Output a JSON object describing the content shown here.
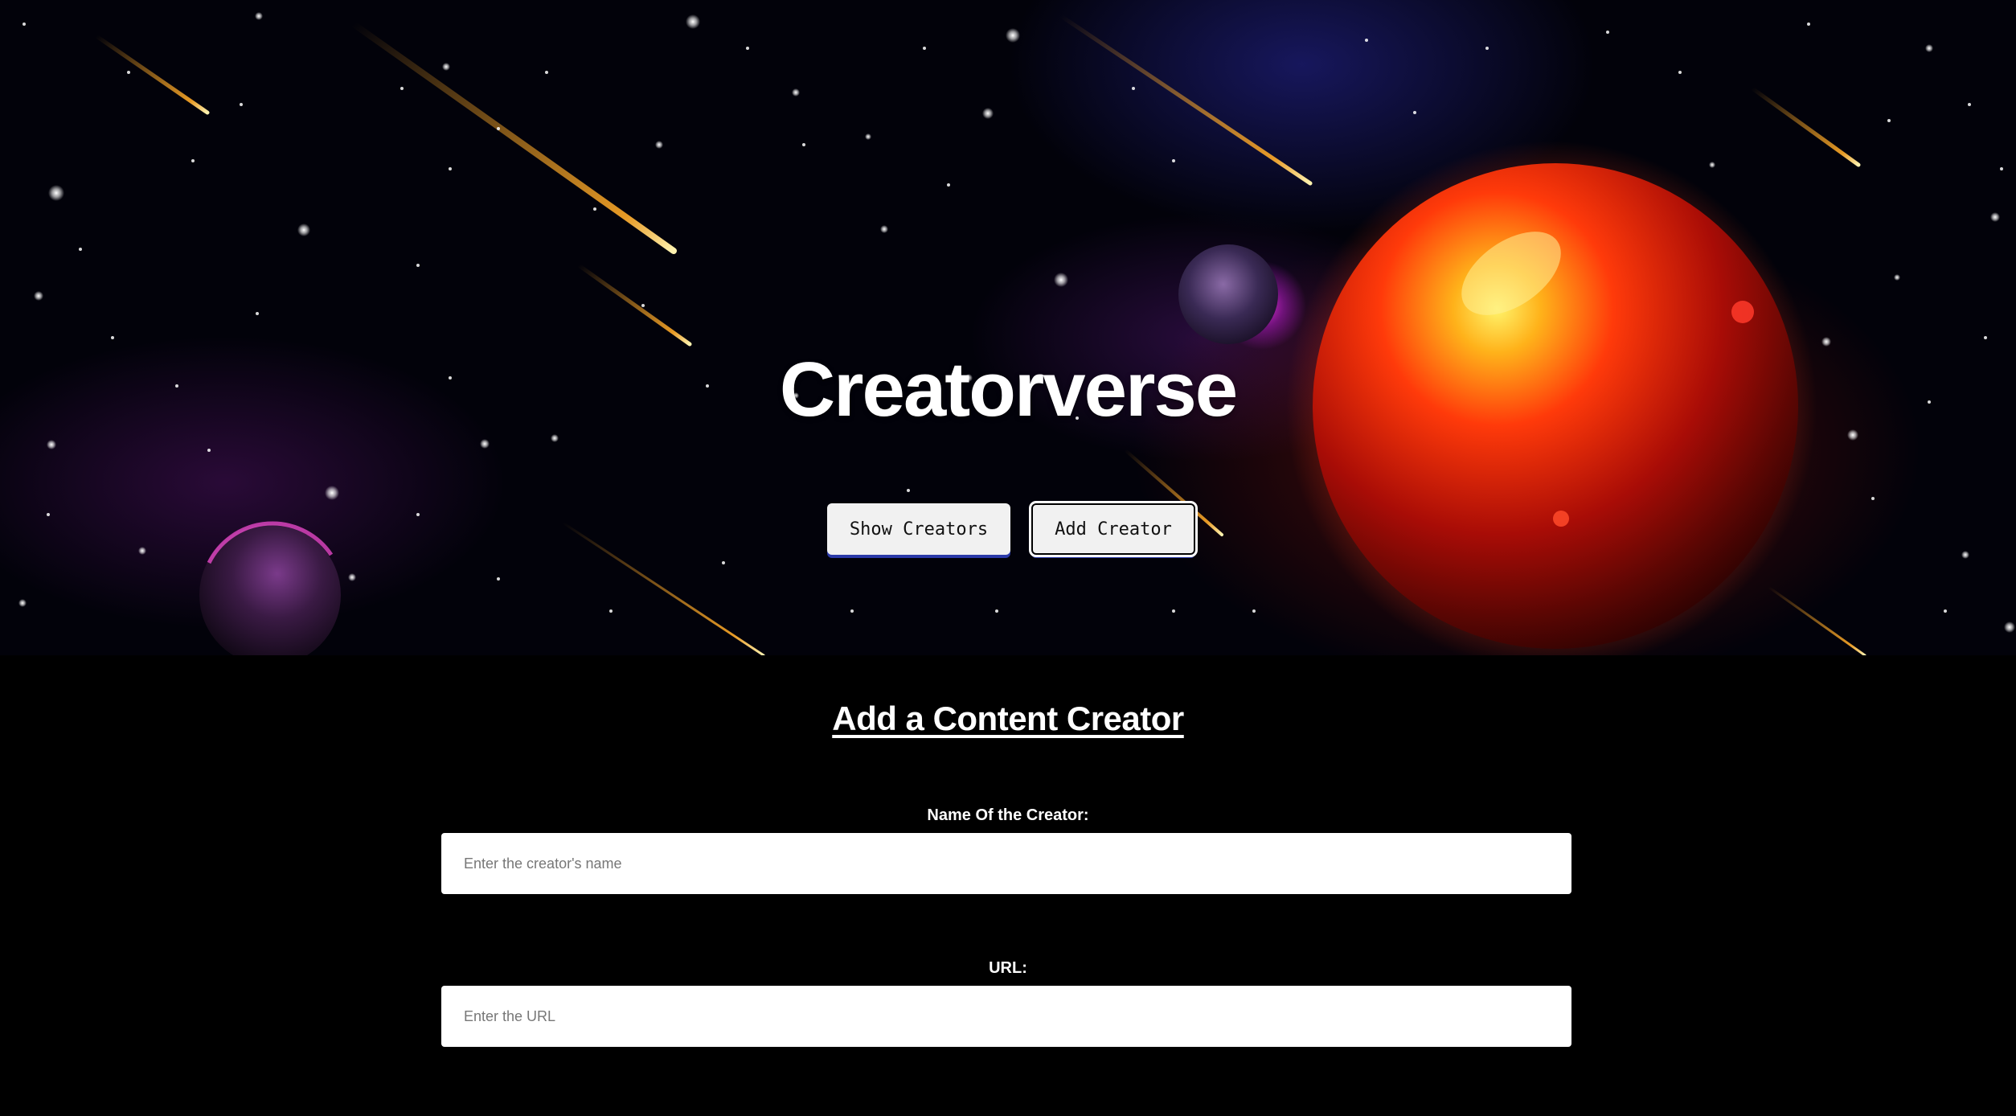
{
  "hero": {
    "title": "Creatorverse",
    "buttons": {
      "show_creators": "Show Creators",
      "add_creator": "Add Creator"
    }
  },
  "form": {
    "heading": "Add a Content Creator",
    "fields": [
      {
        "label": "Name Of the Creator:",
        "placeholder": "Enter the creator's name",
        "value": ""
      },
      {
        "label": "URL:",
        "placeholder": "Enter the URL",
        "value": ""
      }
    ]
  },
  "colors": {
    "page_background": "#000000",
    "button_background": "#f1f1f1",
    "button_accent": "#2b3aa8",
    "text": "#ffffff"
  }
}
